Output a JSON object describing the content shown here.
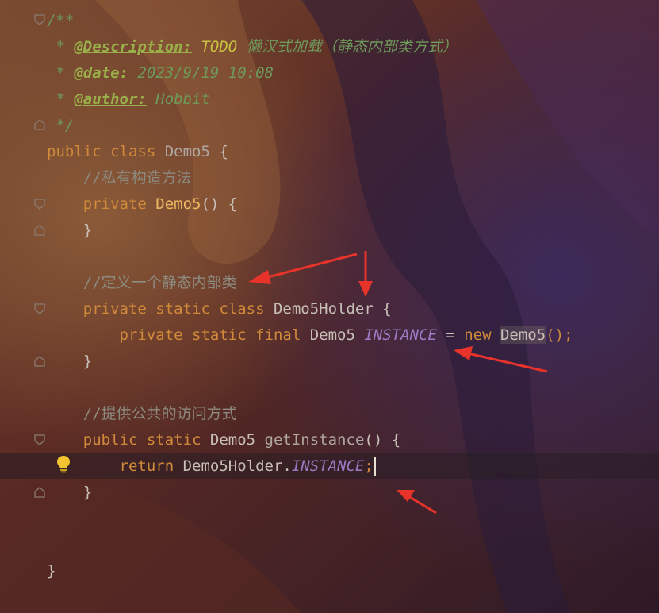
{
  "colors": {
    "keyword": "#d08a3a",
    "function": "#f0b860",
    "comment": "#8d8a80",
    "doc_comment": "#6e9a5a",
    "constant": "#9a7bc4",
    "annotation_arrow": "#e8332a"
  },
  "icons": {
    "gutter_fold": "fold-icon",
    "intention": "lightbulb-icon",
    "annotation": "red-arrow"
  },
  "code": {
    "l1": {
      "text": "/**"
    },
    "l2": {
      "star": " * ",
      "tag": "@Description:",
      "todo": " TODO",
      "text": " 懒汉式加载（静态内部类方式）"
    },
    "l3": {
      "star": " * ",
      "tag": "@date:",
      "text": " 2023/9/19 10:08"
    },
    "l4": {
      "star": " * ",
      "tag": "@author:",
      "text": " Hobbit"
    },
    "l5": {
      "text": " */"
    },
    "l6": {
      "kw": "public class ",
      "name": "Demo5",
      "rest": " {"
    },
    "l7": {
      "text": "    //私有构造方法"
    },
    "l8": {
      "kw": "    private ",
      "name": "Demo5",
      "rest": "() {"
    },
    "l9": {
      "text": "    }"
    },
    "l10": {
      "text": "    //定义一个静态内部类"
    },
    "l11": {
      "kw": "    private static class ",
      "name": "Demo5Holder",
      "rest": " {"
    },
    "l12": {
      "kw": "        private static final ",
      "type": "Demo5",
      "const": " INSTANCE",
      "op": " = ",
      "new": "new ",
      "ctor": "Demo5",
      "rest": "();"
    },
    "l13": {
      "text": "    }"
    },
    "l14": {
      "text": "    //提供公共的访问方式"
    },
    "l15": {
      "kw": "    public static ",
      "type": "Demo5",
      "fn": " getInstance",
      "rest": "() {"
    },
    "l16": {
      "kw": "        return ",
      "type": "Demo5Holder.",
      "const": "INSTANCE",
      "rest": ";"
    },
    "l17": {
      "text": "    }"
    },
    "l18": {
      "text": "}"
    }
  }
}
